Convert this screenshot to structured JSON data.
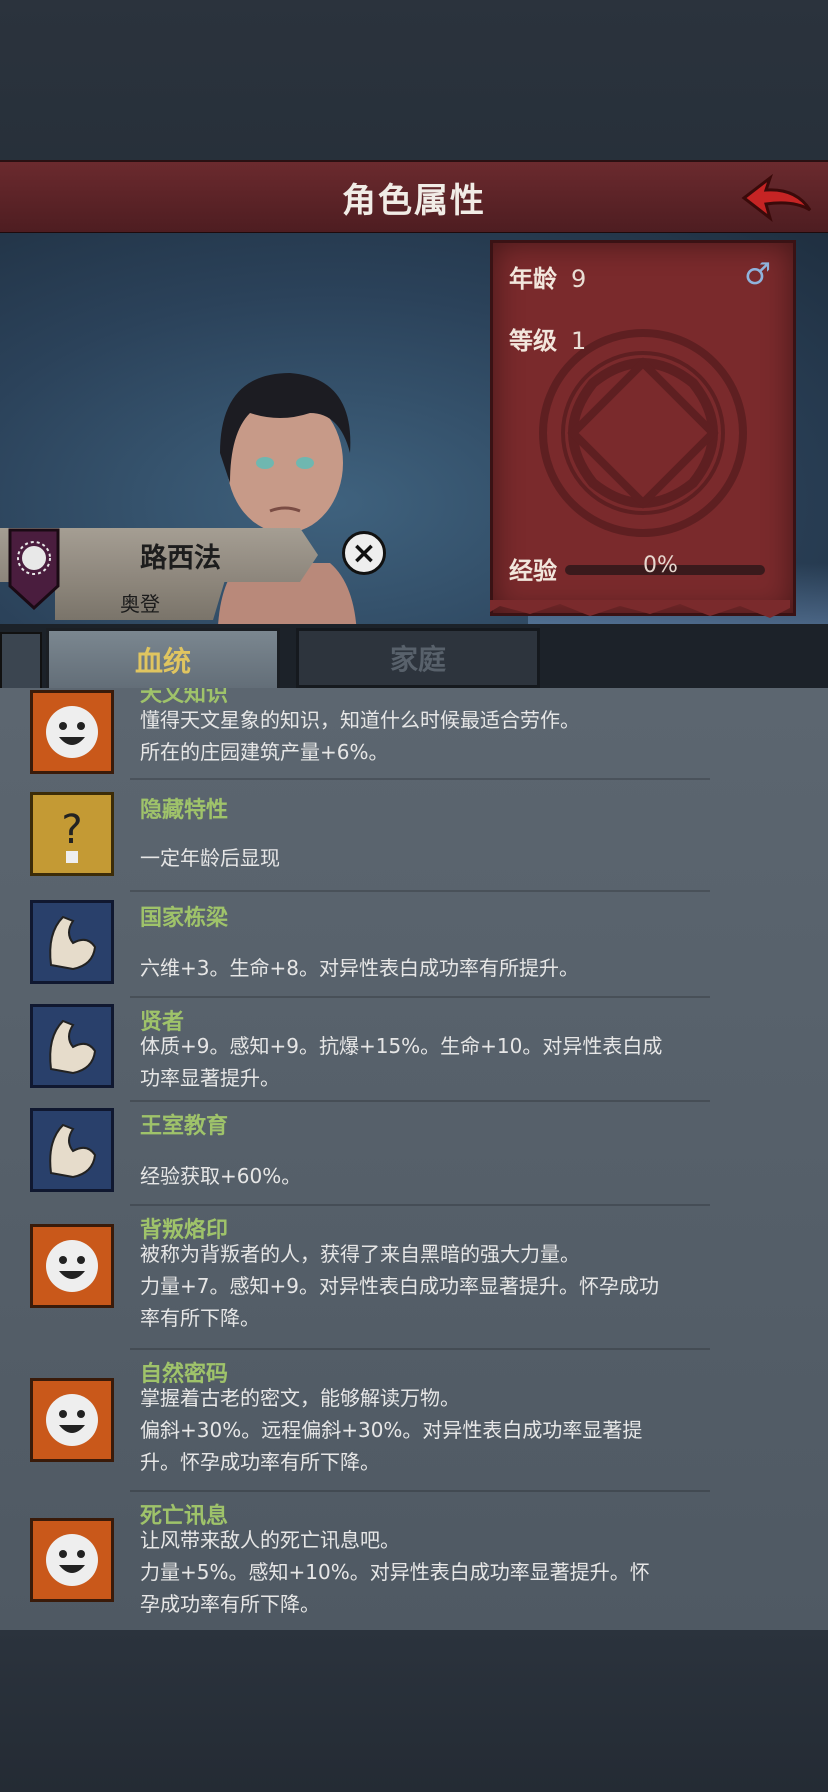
{
  "header": {
    "title": "角色属性"
  },
  "character": {
    "name": "路西法",
    "house": "奥登",
    "age_label": "年龄",
    "age_value": "9",
    "level_label": "等级",
    "level_value": "1",
    "exp_label": "经验",
    "exp_percent": "0%",
    "exp_fraction": 0,
    "gender_symbol": "♂"
  },
  "tabs": [
    {
      "label": "血统",
      "active": true
    },
    {
      "label": "家庭",
      "active": false
    }
  ],
  "traits": [
    {
      "name": "天文知识",
      "icon": "smile-icon",
      "lines": [
        "懂得天文星象的知识，知道什么时候最适合劳作。",
        "所在的庄园建筑产量+6%。"
      ]
    },
    {
      "name": "隐藏特性",
      "icon": "question-icon",
      "lines": [
        "一定年龄后显现"
      ]
    },
    {
      "name": "国家栋梁",
      "icon": "muscle-icon",
      "lines": [
        "六维+3。生命+8。对异性表白成功率有所提升。"
      ]
    },
    {
      "name": "贤者",
      "icon": "muscle-icon",
      "lines": [
        "体质+9。感知+9。抗爆+15%。生命+10。对异性表白成",
        "功率显著提升。"
      ]
    },
    {
      "name": "王室教育",
      "icon": "muscle-icon",
      "lines": [
        "经验获取+60%。"
      ]
    },
    {
      "name": "背叛烙印",
      "icon": "smile-icon",
      "lines": [
        "被称为背叛者的人，获得了来自黑暗的强大力量。",
        "力量+7。感知+9。对异性表白成功率显著提升。怀孕成功",
        "率有所下降。"
      ]
    },
    {
      "name": "自然密码",
      "icon": "smile-icon",
      "lines": [
        "掌握着古老的密文，能够解读万物。",
        "偏斜+30%。远程偏斜+30%。对异性表白成功率显著提",
        "升。怀孕成功率有所下降。"
      ]
    },
    {
      "name": "死亡讯息",
      "icon": "smile-icon",
      "lines": [
        "让风带来敌人的死亡讯息吧。",
        "力量+5%。感知+10%。对异性表白成功率显著提升。怀",
        "孕成功率有所下降。"
      ]
    }
  ],
  "colors": {
    "header_bg": "#6b2a2e",
    "trait_name": "#9fc36a",
    "active_tab_text": "#e0c560"
  }
}
